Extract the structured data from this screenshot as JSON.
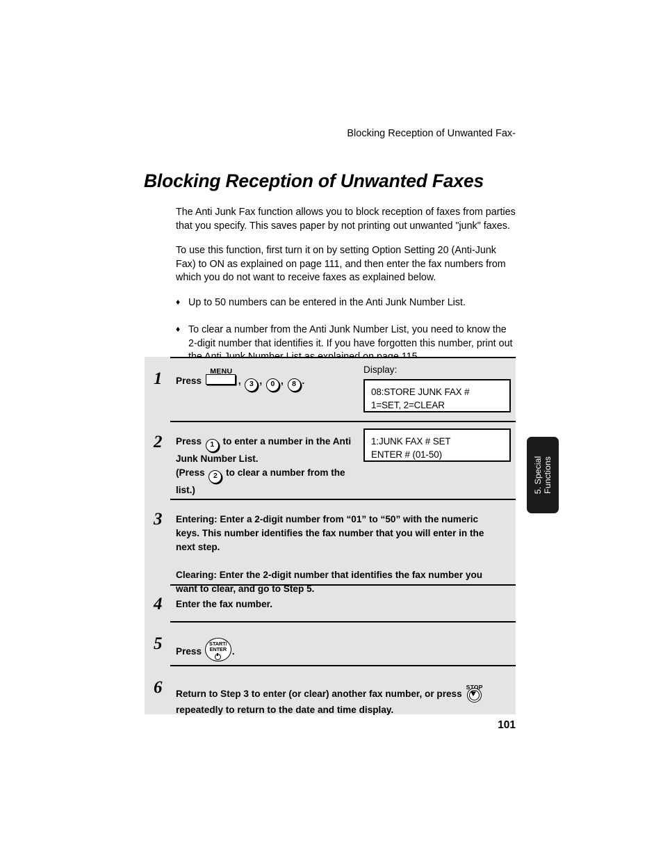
{
  "running_header": "Blocking Reception of Unwanted Fax-",
  "page_title": "Blocking Reception of Unwanted Faxes",
  "folio": "101",
  "chapter_tab": {
    "label": "5. Special\nFunctions",
    "background": "#1a1a1a",
    "text_color": "#ffffff"
  },
  "intro": {
    "paragraphs": [
      "The Anti Junk Fax function allows you to block reception of faxes from parties that you specify. This saves paper by not printing out unwanted \"junk\" faxes.",
      "To use this function, first turn it on by setting Option Setting 20 (Anti-Junk Fax) to ON as explained on page 111, and then enter the fax numbers from which you do not want to receive faxes as explained below."
    ],
    "bullets": [
      {
        "marker": "♦",
        "text": "Up to 50 numbers can be entered in the Anti Junk Number List."
      },
      {
        "marker": "♦",
        "text": "To clear a number from the Anti Junk Number List, you need to know the 2-digit number that identifies it. If you have forgotten this number, print out the Anti Junk Number List as explained on page 115."
      }
    ]
  },
  "procedure": {
    "panel_color": "#e4e4e4",
    "steps": [
      {
        "number": "1",
        "press_label": "Press",
        "keys": [
          {
            "type": "menu-key",
            "label": "MENU"
          },
          {
            "type": "separator",
            "label": ","
          },
          {
            "type": "round-key",
            "label": "3"
          },
          {
            "type": "separator",
            "label": ","
          },
          {
            "type": "round-key",
            "label": "0"
          },
          {
            "type": "separator",
            "label": ","
          },
          {
            "type": "round-key",
            "label": "8"
          },
          {
            "type": "separator",
            "label": "."
          }
        ],
        "display_label": "Display:",
        "display_lines": [
          "08:STORE JUNK FAX #",
          "1=SET, 2=CLEAR"
        ]
      },
      {
        "number": "2",
        "line1_a": "Press",
        "key1": "1",
        "line1_b": "to enter a number in the Anti",
        "line2": "Junk Number List.",
        "line3_a": "(Press",
        "key2": "2",
        "line3_b": "to clear a number from the",
        "line4": "list.)",
        "display_lines": [
          "1:JUNK FAX # SET",
          "ENTER # (01-50)"
        ]
      },
      {
        "number": "3",
        "paragraph1": "Entering: Enter a 2-digit number from “01” to “50” with the numeric keys. This number identifies the fax number that you will enter in the next step.",
        "paragraph2": "Clearing: Enter the 2-digit number that identifies the fax number you want to clear, and go to Step 5."
      },
      {
        "number": "4",
        "text": "Enter the fax number."
      },
      {
        "number": "5",
        "press_label": "Press",
        "key_oval_line1": "START/",
        "key_oval_line2": "ENTER",
        "trailing": "."
      },
      {
        "number": "6",
        "line1": "Return to Step 3 to enter (or clear) another fax number, or press",
        "stop_key_label": "STOP",
        "line2": "repeatedly to return to the date and time display."
      }
    ]
  }
}
